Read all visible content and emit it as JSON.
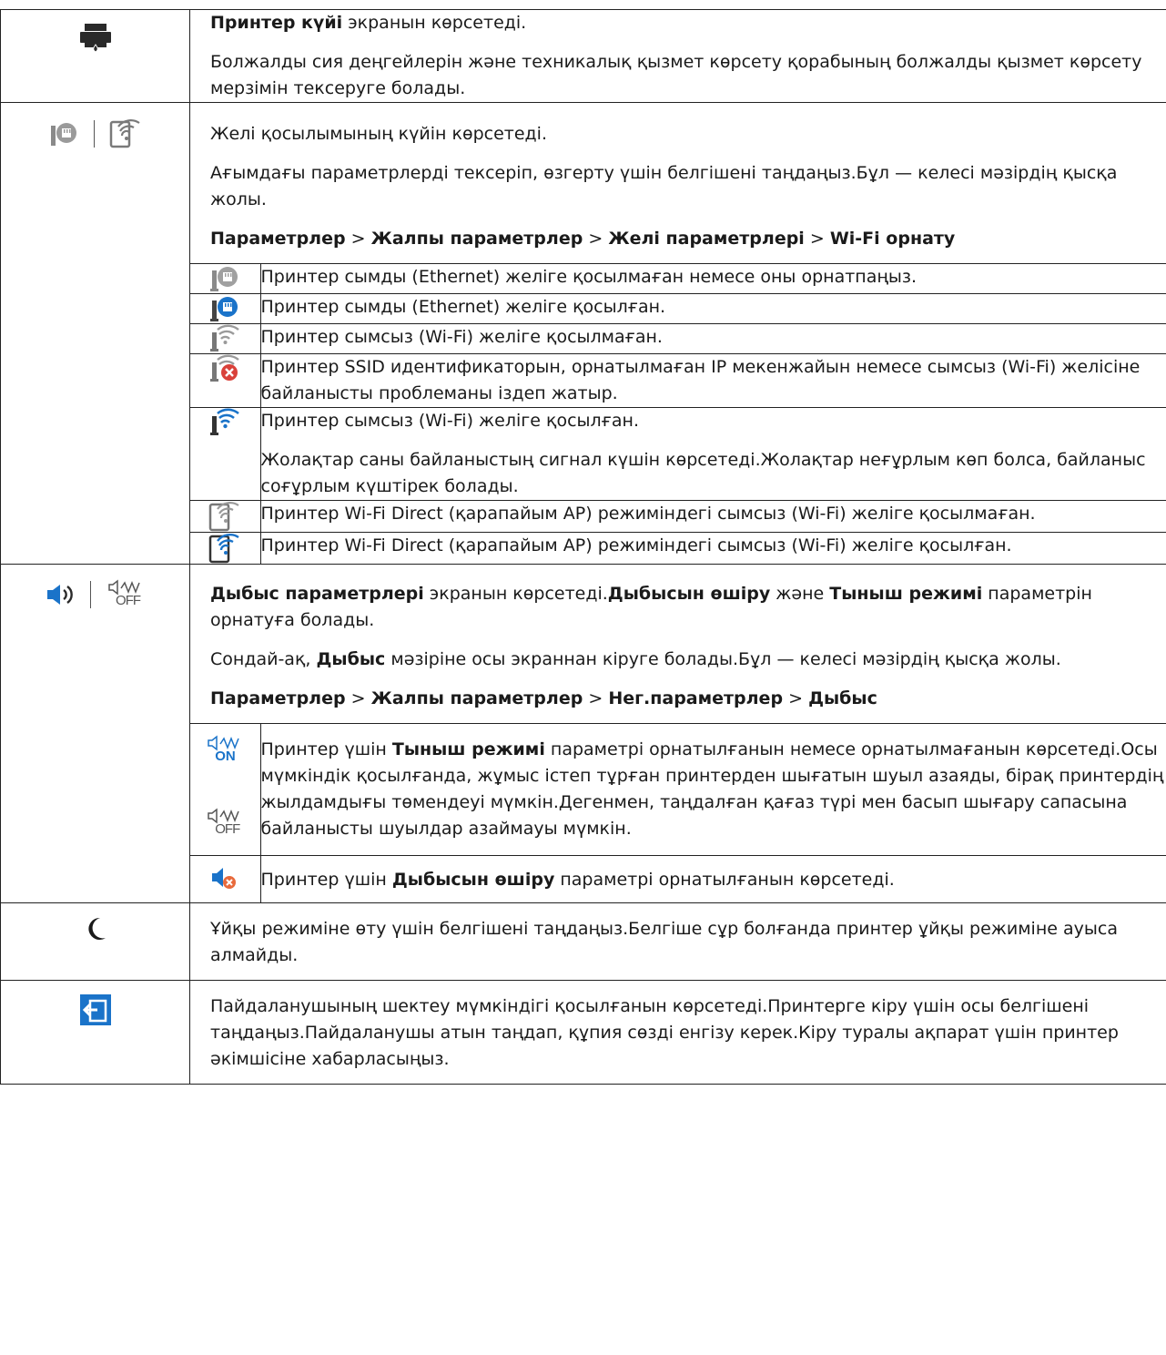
{
  "rows": {
    "printer": {
      "icon": "printer-ink-icon",
      "bold": "Принтер күйі",
      "text1": " экранын көрсетеді.",
      "text2": "Болжалды сия деңгейлерін және техникалық қызмет көрсету қорабының болжалды қызмет көрсету мерзімін тексеруге болады."
    },
    "network": {
      "icons": [
        "ethernet-icon",
        "wifi-direct-icon"
      ],
      "p1": "Желі қосылымының күйін көрсетеді.",
      "p2": "Ағымдағы параметрлерді тексеріп, өзгерту үшін белгішені таңдаңыз.Бұл — келесі мәзірдің қысқа жолы.",
      "path": [
        "Параметрлер",
        "Жалпы параметрлер",
        "Желі параметрлері",
        "Wi-Fi орнату"
      ],
      "sep": " > ",
      "sub": [
        {
          "icon": "ethernet-disconnected-icon",
          "text": "Принтер сымды (Ethernet) желіге қосылмаған немесе оны орнатпаңыз."
        },
        {
          "icon": "ethernet-connected-icon",
          "text": "Принтер сымды (Ethernet) желіге қосылған."
        },
        {
          "icon": "wifi-disconnected-icon",
          "text": "Принтер сымсыз (Wi-Fi) желіге қосылмаған."
        },
        {
          "icon": "wifi-error-icon",
          "text": "Принтер SSID идентификаторын, орнатылмаған IP мекенжайын немесе сымсыз (Wi-Fi) желісіне байланысты проблеманы іздеп жатыр."
        },
        {
          "icon": "wifi-connected-icon",
          "text": "Принтер сымсыз (Wi-Fi) желіге қосылған.",
          "text2": "Жолақтар саны байланыстың сигнал күшін көрсетеді.Жолақтар неғұрлым көп болса, байланыс соғұрлым күштірек болады."
        },
        {
          "icon": "wifi-direct-disconnected-icon",
          "text": "Принтер Wi-Fi Direct (қарапайым AP) режиміндегі сымсыз (Wi-Fi) желіге қосылмаған."
        },
        {
          "icon": "wifi-direct-connected-icon",
          "text": "Принтер Wi-Fi Direct (қарапайым AP) режиміндегі сымсыз (Wi-Fi) желіге қосылған."
        }
      ]
    },
    "sound": {
      "icons": [
        "speaker-icon",
        "quiet-off-icon"
      ],
      "p1_bold1": "Дыбыс параметрлері",
      "p1_t1": " экранын көрсетеді.",
      "p1_bold2": "Дыбысын өшіру",
      "p1_t2": " және ",
      "p1_bold3": "Тыныш режимі",
      "p1_t3": " параметрін орнатуға болады.",
      "p2_t1": "Сондай-ақ, ",
      "p2_bold": "Дыбыс",
      "p2_t2": " мәзіріне осы экраннан кіруге болады.Бұл — келесі мәзірдің қысқа жолы.",
      "path": [
        "Параметрлер",
        "Жалпы параметрлер",
        "Нег.параметрлер",
        "Дыбыс"
      ],
      "sep": " > ",
      "sub1_t1": "Принтер үшін ",
      "sub1_bold": "Тыныш режимі",
      "sub1_t2": " параметрі орнатылғанын немесе орнатылмағанын көрсетеді.Осы мүмкіндік қосылғанда, жұмыс істеп тұрған принтерден шығатын шуыл азаяды, бірақ принтердің жылдамдығы төмендеуі мүмкін.Дегенмен, таңдалған қағаз түрі мен басып шығару сапасына байланысты шуылдар азаймауы мүмкін.",
      "quiet_on_label": "ON",
      "quiet_off_label": "OFF",
      "sub2_t1": "Принтер үшін ",
      "sub2_bold": "Дыбысын өшіру",
      "sub2_t2": " параметрі орнатылғанын көрсетеді."
    },
    "sleep": {
      "icon": "moon-icon",
      "text": "Ұйқы режиміне өту үшін белгішені таңдаңыз.Белгіше сұр болғанда принтер ұйқы режиміне ауыса алмайды."
    },
    "login": {
      "icon": "login-icon",
      "text": "Пайдаланушының шектеу мүмкіндігі қосылғанын көрсетеді.Принтерге кіру үшін осы белгішені таңдаңыз.Пайдаланушы атын таңдап, құпия сөзді енгізу керек.Кіру туралы ақпарат үшін принтер әкімшісіне хабарласыңыз."
    }
  },
  "colors": {
    "icon_blue": "#1a73c9",
    "icon_gray": "#7a7a7a",
    "icon_dark": "#2a2a2a",
    "error_red": "#d9413a"
  }
}
